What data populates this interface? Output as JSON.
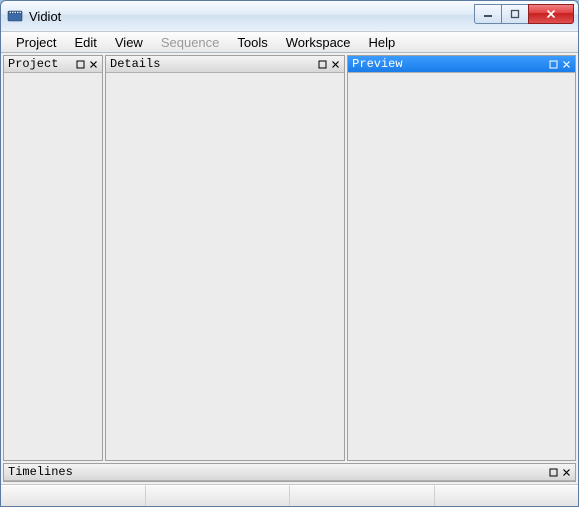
{
  "window": {
    "title": "Vidiot"
  },
  "menubar": {
    "items": [
      {
        "label": "Project",
        "enabled": true
      },
      {
        "label": "Edit",
        "enabled": true
      },
      {
        "label": "View",
        "enabled": true
      },
      {
        "label": "Sequence",
        "enabled": false
      },
      {
        "label": "Tools",
        "enabled": true
      },
      {
        "label": "Workspace",
        "enabled": true
      },
      {
        "label": "Help",
        "enabled": true
      }
    ]
  },
  "panels": {
    "project": {
      "title": "Project",
      "active": false
    },
    "details": {
      "title": "Details",
      "active": false
    },
    "preview": {
      "title": "Preview",
      "active": true
    },
    "timelines": {
      "title": "Timelines",
      "active": false
    }
  }
}
